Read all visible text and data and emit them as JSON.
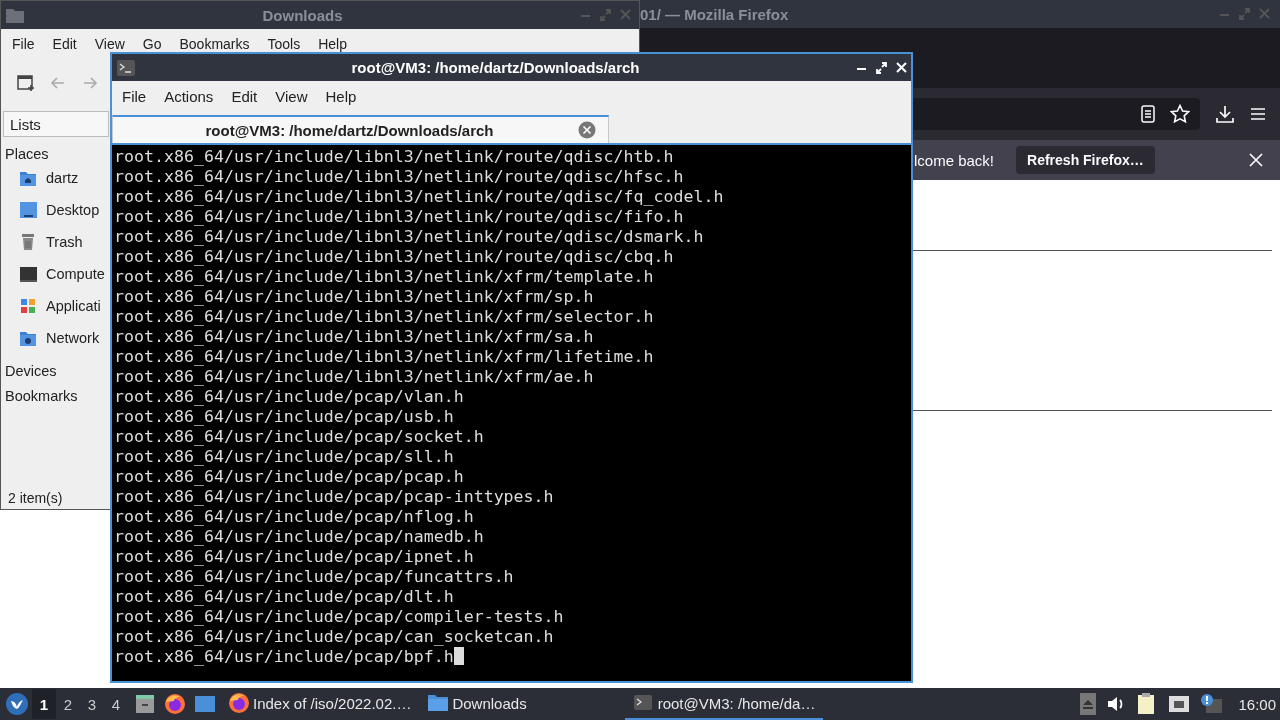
{
  "file_manager": {
    "title": "Downloads",
    "menu": [
      "File",
      "Edit",
      "View",
      "Go",
      "Bookmarks",
      "Tools",
      "Help"
    ],
    "sidebar_tab": "Lists",
    "sections": [
      {
        "label": "Places",
        "items": [
          {
            "label": "dartz",
            "kind": "home"
          },
          {
            "label": "Desktop",
            "kind": "desktop"
          },
          {
            "label": "Trash",
            "kind": "trash"
          },
          {
            "label": "Compute",
            "kind": "computer"
          },
          {
            "label": "Applicati",
            "kind": "apps"
          },
          {
            "label": "Network",
            "kind": "network"
          }
        ]
      },
      {
        "label": "Devices"
      },
      {
        "label": "Bookmarks"
      }
    ],
    "status": "2 item(s)"
  },
  "firefox": {
    "title": "01/ — Mozilla Firefox",
    "notification": "lcome back!",
    "notification_button": "Refresh Firefox…"
  },
  "terminal": {
    "title": "root@VM3: /home/dartz/Downloads/arch",
    "menu": [
      "File",
      "Actions",
      "Edit",
      "View",
      "Help"
    ],
    "tabs": [
      {
        "label": "root@VM3: /home/dartz/Downloads/arch",
        "selected": true
      }
    ],
    "lines": [
      "root.x86_64/usr/include/libnl3/netlink/route/qdisc/htb.h",
      "root.x86_64/usr/include/libnl3/netlink/route/qdisc/hfsc.h",
      "root.x86_64/usr/include/libnl3/netlink/route/qdisc/fq_codel.h",
      "root.x86_64/usr/include/libnl3/netlink/route/qdisc/fifo.h",
      "root.x86_64/usr/include/libnl3/netlink/route/qdisc/dsmark.h",
      "root.x86_64/usr/include/libnl3/netlink/route/qdisc/cbq.h",
      "root.x86_64/usr/include/libnl3/netlink/xfrm/template.h",
      "root.x86_64/usr/include/libnl3/netlink/xfrm/sp.h",
      "root.x86_64/usr/include/libnl3/netlink/xfrm/selector.h",
      "root.x86_64/usr/include/libnl3/netlink/xfrm/sa.h",
      "root.x86_64/usr/include/libnl3/netlink/xfrm/lifetime.h",
      "root.x86_64/usr/include/libnl3/netlink/xfrm/ae.h",
      "root.x86_64/usr/include/pcap/vlan.h",
      "root.x86_64/usr/include/pcap/usb.h",
      "root.x86_64/usr/include/pcap/socket.h",
      "root.x86_64/usr/include/pcap/sll.h",
      "root.x86_64/usr/include/pcap/pcap.h",
      "root.x86_64/usr/include/pcap/pcap-inttypes.h",
      "root.x86_64/usr/include/pcap/nflog.h",
      "root.x86_64/usr/include/pcap/namedb.h",
      "root.x86_64/usr/include/pcap/ipnet.h",
      "root.x86_64/usr/include/pcap/funcattrs.h",
      "root.x86_64/usr/include/pcap/dlt.h",
      "root.x86_64/usr/include/pcap/compiler-tests.h",
      "root.x86_64/usr/include/pcap/can_socketcan.h",
      "root.x86_64/usr/include/pcap/bpf.h"
    ]
  },
  "taskbar": {
    "workspaces": [
      {
        "label": "1",
        "selected": true
      },
      {
        "label": "2",
        "selected": false
      },
      {
        "label": "3",
        "selected": false
      },
      {
        "label": "4",
        "selected": false
      }
    ],
    "tasks": [
      {
        "label": "Index of /iso/2022.02.…",
        "kind": "firefox",
        "selected": false
      },
      {
        "label": "Downloads",
        "kind": "folder",
        "selected": false
      },
      {
        "label": "root@VM3: /home/da…",
        "kind": "terminal",
        "selected": true
      }
    ],
    "clock": "16:00"
  }
}
